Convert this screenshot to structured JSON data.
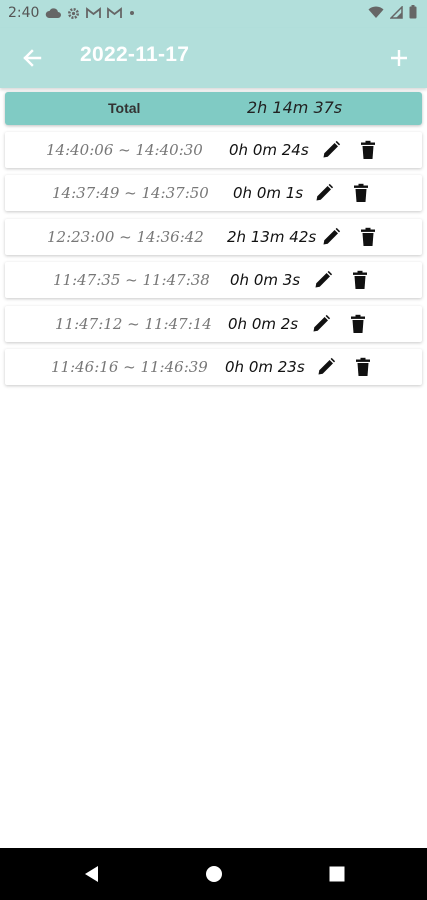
{
  "status_bar": {
    "time": "2:40",
    "left_icons": [
      "cloud-icon",
      "gear-icon",
      "gmail-icon",
      "gmail-icon",
      "dot-icon"
    ],
    "right_icons": [
      "wifi-icon",
      "signal-icon",
      "battery-icon"
    ]
  },
  "app_bar": {
    "title": "2022-11-17",
    "back_icon": "arrow-left-icon",
    "add_icon": "plus-icon"
  },
  "total": {
    "label": "Total",
    "value": "2h 14m 37s"
  },
  "sessions": [
    {
      "range": "14:40:06 ~ 14:40:30",
      "duration": "0h 0m 24s"
    },
    {
      "range": "14:37:49 ~ 14:37:50",
      "duration": "0h 0m 1s"
    },
    {
      "range": "12:23:00 ~ 14:36:42",
      "duration": "2h 13m 42s"
    },
    {
      "range": "11:47:35 ~ 11:47:38",
      "duration": "0h 0m 3s"
    },
    {
      "range": "11:47:12 ~ 11:47:14",
      "duration": "0h 0m 2s"
    },
    {
      "range": "11:46:16 ~ 11:46:39",
      "duration": "0h 0m 23s"
    }
  ],
  "colors": {
    "app_bar": "#b2dfdb",
    "total_bar": "#80cbc4",
    "nav_bar": "#000000"
  }
}
